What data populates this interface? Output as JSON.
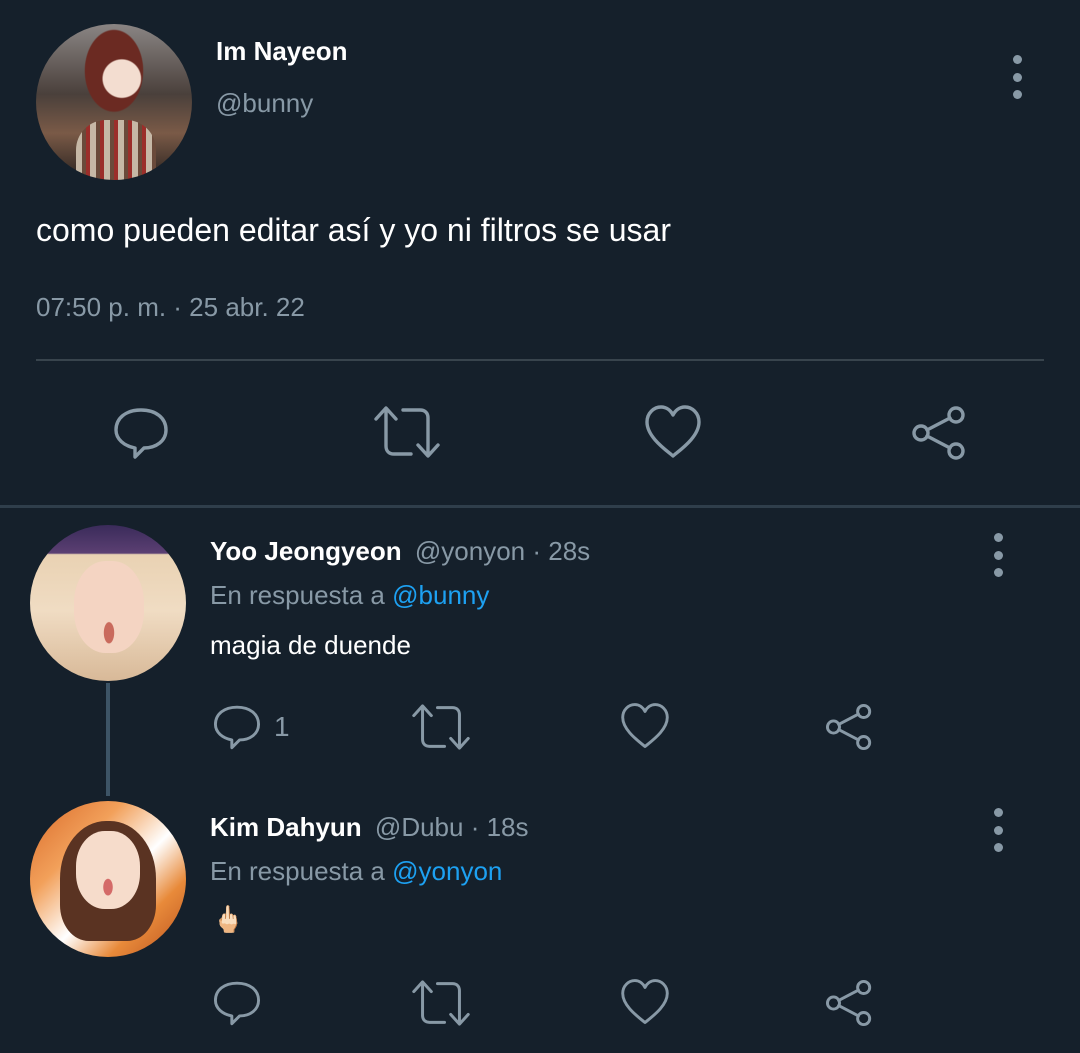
{
  "main_tweet": {
    "author_name": "Im Nayeon",
    "author_handle": "@bunny",
    "text": "como pueden editar así y yo ni filtros se usar",
    "timestamp": "07:50 p. m. · 25 abr. 22",
    "actions": {
      "reply_icon": "reply-icon",
      "retweet_icon": "retweet-icon",
      "like_icon": "like-icon",
      "share_icon": "share-icon"
    }
  },
  "replies": [
    {
      "author_name": "Yoo Jeongyeon",
      "author_handle": "@yonyon",
      "time_ago": "· 28s",
      "in_reply_to_label": "En respuesta a",
      "in_reply_to_handle": "@bunny",
      "text": "magia de duende",
      "reply_count": "1"
    },
    {
      "author_name": "Kim Dahyun",
      "author_handle": "@Dubu",
      "time_ago": "· 18s",
      "in_reply_to_label": "En respuesta a",
      "in_reply_to_handle": "@yonyon",
      "text": "🖕🏻",
      "reply_count": ""
    }
  ],
  "colors": {
    "background": "#15202b",
    "muted": "#8899a6",
    "link": "#1da1f2",
    "divider": "#38444d"
  }
}
